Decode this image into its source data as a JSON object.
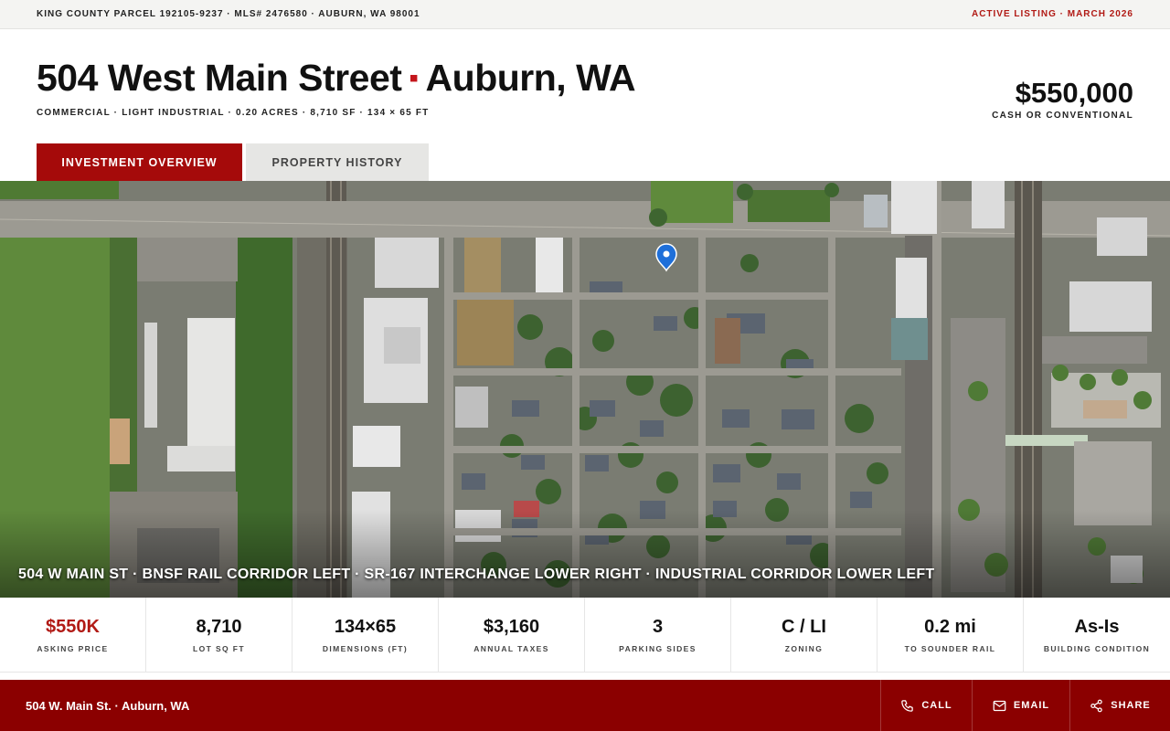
{
  "topbar": {
    "parcel_info": "KING COUNTY PARCEL 192105-9237 · MLS# 2476580 · AUBURN, WA 98001",
    "status": "ACTIVE LISTING · MARCH 2026"
  },
  "header": {
    "street": "504 West Main Street",
    "separator": "▪",
    "city": "Auburn, WA",
    "subtitle": "COMMERCIAL · LIGHT INDUSTRIAL · 0.20 ACRES · 8,710 SF · 134 × 65 FT",
    "price": "$550,000",
    "price_note": "CASH OR CONVENTIONAL"
  },
  "tabs": [
    {
      "label": "INVESTMENT OVERVIEW",
      "active": true
    },
    {
      "label": "PROPERTY HISTORY",
      "active": false
    }
  ],
  "aerial": {
    "caption": "504 W MAIN ST · BNSF RAIL CORRIDOR LEFT · SR-167 INTERCHANGE LOWER RIGHT · INDUSTRIAL CORRIDOR LOWER LEFT",
    "marker_icon": "location-pin-icon",
    "marker_color": "#1e6fd9"
  },
  "stats": [
    {
      "value": "$550K",
      "label": "ASKING PRICE",
      "accent": true
    },
    {
      "value": "8,710",
      "label": "LOT SQ FT"
    },
    {
      "value": "134×65",
      "label": "DIMENSIONS (FT)"
    },
    {
      "value": "$3,160",
      "label": "ANNUAL TAXES"
    },
    {
      "value": "3",
      "label": "PARKING SIDES"
    },
    {
      "value": "C / LI",
      "label": "ZONING"
    },
    {
      "value": "0.2 mi",
      "label": "TO SOUNDER RAIL"
    },
    {
      "value": "As-Is",
      "label": "BUILDING CONDITION"
    }
  ],
  "bottombar": {
    "address": "504 W. Main St. · Auburn, WA",
    "call_label": "CALL",
    "email_label": "EMAIL",
    "share_label": "SHARE"
  },
  "colors": {
    "accent": "#a50a0a",
    "bottombar": "#8b0000",
    "status_text": "#b11a15"
  }
}
